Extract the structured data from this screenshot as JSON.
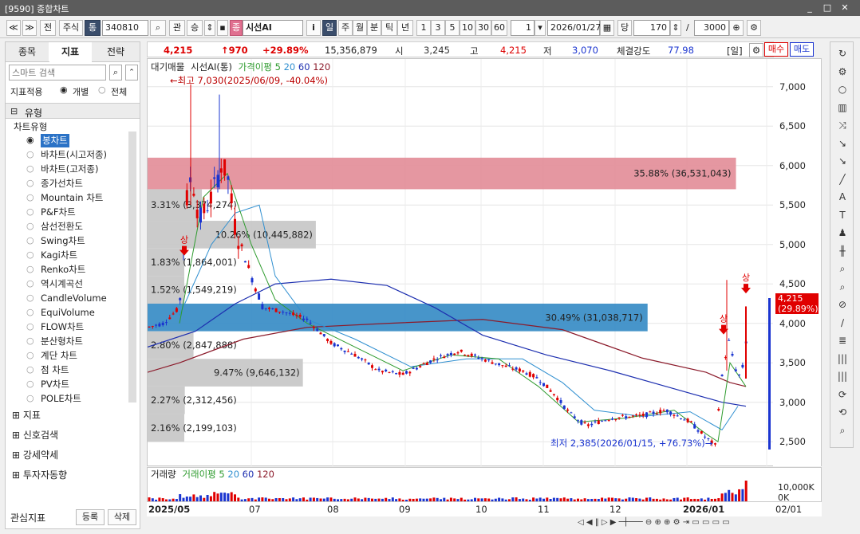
{
  "window": {
    "title": "[9590] 종합차트"
  },
  "toolbar": {
    "btn_prev": "≪",
    "btn_down": "≫",
    "btn_jeon": "전",
    "btn_stock": "주식",
    "btn_tong": "통",
    "code": "340810",
    "btn_gwan": "관",
    "btn_sung": "승",
    "btn_pink": "종",
    "stock_name": "시선AI",
    "btn_info": "i",
    "periods": [
      "일",
      "주",
      "월",
      "분",
      "틱",
      "년"
    ],
    "intervals": [
      "1",
      "3",
      "5",
      "10",
      "30",
      "60"
    ],
    "count_value": "1",
    "date": "2026/01/27",
    "btn_dang": "당",
    "view_count": "170",
    "slash": "/",
    "total_count": "3000"
  },
  "left_panel": {
    "tabs": [
      "종목",
      "지표",
      "전략"
    ],
    "search_placeholder": "스마트 검색",
    "apply_label": "지표적용",
    "radio_individual": "개별",
    "radio_all": "전체",
    "section_type": "유형",
    "chart_type_header": "차트유형",
    "chart_types": [
      "봉차트",
      "바차트(시고저종)",
      "바차트(고저종)",
      "종가선차트",
      "Mountain 차트",
      "P&F차트",
      "삼선전환도",
      "Swing차트",
      "Kagi차트",
      "Renko차트",
      "역시계곡선",
      "CandleVolume",
      "EquiVolume",
      "FLOW차트",
      "분산형차트",
      "계단 차트",
      "점 차트",
      "PV차트",
      "POLE차트"
    ],
    "sections": [
      "지표",
      "신호검색",
      "강세약세",
      "투자자동향",
      "관심지표"
    ],
    "btn_register": "등록",
    "btn_delete": "삭제"
  },
  "infobar": {
    "price": "4,215",
    "change": "↑970",
    "change_pct": "+29.89%",
    "volume": "15,356,879",
    "open_label": "시",
    "open": "3,245",
    "high_label": "고",
    "high": "4,215",
    "low_label": "저",
    "low": "3,070",
    "strength_label": "체결강도",
    "strength": "77.98",
    "period_tag": "[일]",
    "buy": "매수",
    "sell": "매도"
  },
  "chart": {
    "legend": {
      "main": "대기매물",
      "name": "시선AI(통)",
      "ma_label": "가격이평",
      "ma5": "5",
      "ma20": "20",
      "ma60": "60",
      "ma120": "120"
    },
    "high_note": "←최고 7,030(2025/06/09, -40.04%)",
    "low_note": "최저 2,385(2026/01/15, +76.73%)→",
    "current_price_label": "4,215",
    "current_pct_label": "(29.89%)",
    "up_marks": [
      "상",
      "상",
      "상"
    ],
    "y_ticks": [
      "7,000",
      "6,500",
      "6,000",
      "5,500",
      "5,000",
      "4,500",
      "4,000",
      "3,500",
      "3,000",
      "2,500"
    ],
    "x_ticks": [
      "2025/05",
      "07",
      "08",
      "09",
      "10",
      "11",
      "12",
      "2026/01",
      "02/01"
    ],
    "colors": {
      "up": "#e00000",
      "down": "#1a34d0",
      "ma5": "#2e9b2e",
      "ma20": "#2f8fd0",
      "ma60": "#1d2fb0",
      "ma120": "#8b1a2a",
      "pink_band": "#e4919c",
      "blue_band": "#3d8fc7",
      "gray_band": "#c8c8c8"
    }
  },
  "volume_chart": {
    "label": "거래량",
    "ma_label": "거래이평",
    "ma5": "5",
    "ma20": "20",
    "ma60": "60",
    "ma120": "120",
    "axis_top": "10,000K",
    "axis_bottom": "0K"
  },
  "chart_data": {
    "type": "candlestick",
    "title": "시선AI(통)",
    "ylim": [
      2300,
      7250
    ],
    "volume_profile": [
      {
        "price_low": 5700,
        "price_high": 6100,
        "pct": "35.88%",
        "volume": "(36,531,043)",
        "share": 35.88
      },
      {
        "price_low": 5300,
        "price_high": 5700,
        "pct": "3.31%",
        "volume": "(3,374,274)",
        "share": 3.31
      },
      {
        "price_low": 4950,
        "price_high": 5300,
        "pct": "10.26%",
        "volume": "(10,445,882)",
        "share": 10.26
      },
      {
        "price_low": 4600,
        "price_high": 4950,
        "pct": "1.83%",
        "volume": "(1,864,001)",
        "share": 1.83
      },
      {
        "price_low": 4250,
        "price_high": 4600,
        "pct": "1.52%",
        "volume": "(1,549,219)",
        "share": 1.52
      },
      {
        "price_low": 3900,
        "price_high": 4250,
        "pct": "30.49%",
        "volume": "(31,038,717)",
        "share": 30.49
      },
      {
        "price_low": 3550,
        "price_high": 3900,
        "pct": "2.80%",
        "volume": "(2,847,888)",
        "share": 2.8
      },
      {
        "price_low": 3200,
        "price_high": 3550,
        "pct": "9.47%",
        "volume": "(9,646,132)",
        "share": 9.47
      },
      {
        "price_low": 2850,
        "price_high": 3200,
        "pct": "2.27%",
        "volume": "(2,312,456)",
        "share": 2.27
      },
      {
        "price_low": 2500,
        "price_high": 2850,
        "pct": "2.16%",
        "volume": "(2,199,103)",
        "share": 2.16
      }
    ],
    "high": {
      "value": 7030,
      "date": "2025/06/09"
    },
    "low": {
      "value": 2385,
      "date": "2026/01/15"
    },
    "last": 4215
  }
}
